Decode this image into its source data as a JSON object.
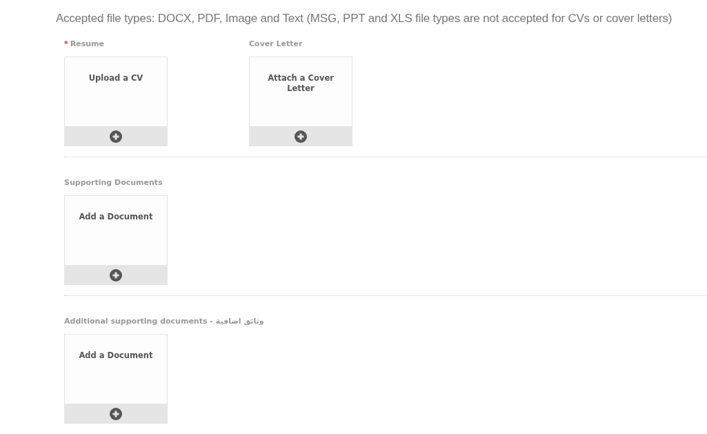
{
  "notice": "Accepted file types: DOCX, PDF, Image and Text (MSG, PPT and XLS file types are not accepted for CVs or cover letters)",
  "sections": [
    {
      "uploads": [
        {
          "required_mark": "*",
          "label": "Resume",
          "card_text": "Upload a CV"
        },
        {
          "label": "Cover Letter",
          "card_text": "Attach a Cover Letter"
        }
      ]
    },
    {
      "uploads": [
        {
          "label": "Supporting Documents",
          "card_text": "Add a Document"
        }
      ]
    },
    {
      "uploads": [
        {
          "label": "Additional supporting documents - وثائق اضافية",
          "card_text": "Add a Document"
        }
      ]
    }
  ]
}
